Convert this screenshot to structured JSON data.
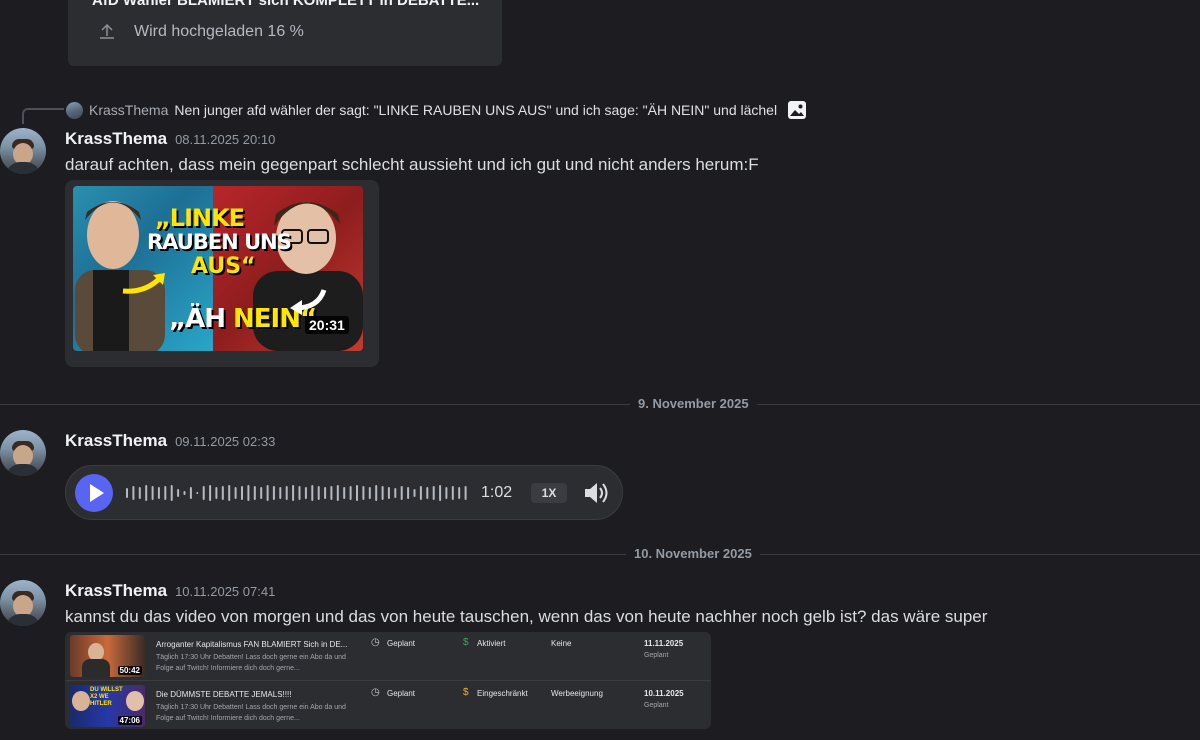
{
  "upload": {
    "title": "AfD Wähler BLAMIERT sich KOMPLETT in DEBATTE...",
    "status": "Wird hochgeladen 16 %"
  },
  "reply": {
    "user": "KrassThema",
    "text": "Nen junger afd wähler der sagt: \"LINKE RAUBEN UNS AUS\" und ich sage: \"ÄH NEIN\" und lächel"
  },
  "messages": [
    {
      "user": "KrassThema",
      "time": "08.11.2025 20:10",
      "text": "darauf achten, dass mein gegenpart schlecht aussieht und ich gut und nicht anders herum:F",
      "video": {
        "line1": "„LINKE",
        "line2": "RAUBEN UNS",
        "line3": "AUS“",
        "line4a": "„ÄH ",
        "line4b": "NEIN“",
        "duration": "20:31"
      }
    },
    {
      "user": "KrassThema",
      "time": "09.11.2025 02:33",
      "voice": {
        "duration": "1:02",
        "speed": "1X",
        "progress": 0
      }
    },
    {
      "user": "KrassThema",
      "time": "10.11.2025 07:41",
      "text": "kannst du das video von morgen und das von heute tauschen, wenn das von heute nachher noch gelb ist? das wäre super"
    }
  ],
  "dividers": [
    "9. November 2025",
    "10. November 2025"
  ],
  "table": {
    "rows": [
      {
        "title": "Arroganter Kapitalismus FAN BLAMIERT Sich in DE...",
        "desc": "Täglich 17:30 Uhr Debatten! Lass doch gerne ein Abo da und Folge auf Twitch! Informiere dich doch gerne...",
        "duration": "50:42",
        "visibility": "Geplant",
        "monetization": "Aktiviert",
        "monetization_color": "#3ba55d",
        "restrictions": "Keine",
        "date": "11.11.2025",
        "date_sub": "Geplant"
      },
      {
        "title": "Die DÜMMSTE DEBATTE JEMALS!!!!",
        "desc": "Täglich 17:30 Uhr Debatten! Lass doch gerne ein Abo da und Folge auf Twitch! Informiere dich doch gerne...",
        "duration": "47:06",
        "thumb_text": "DU WILLST\nX2 WE\nHITLER",
        "visibility": "Geplant",
        "monetization": "Eingeschränkt",
        "monetization_color": "#f0b232",
        "restrictions": "Werbeeignung",
        "date": "10.11.2025",
        "date_sub": "Geplant"
      }
    ]
  }
}
